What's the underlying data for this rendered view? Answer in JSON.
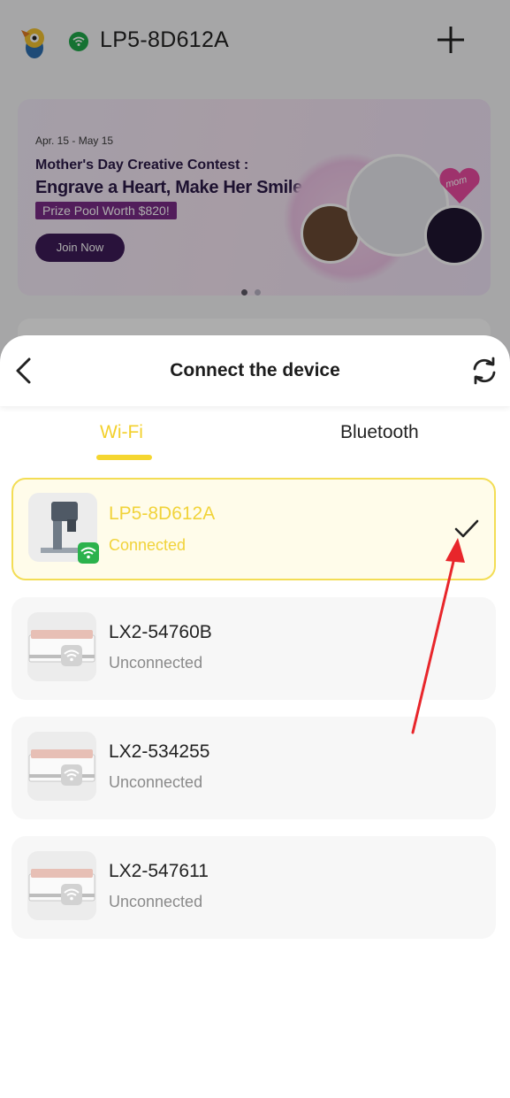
{
  "background": {
    "device_name": "LP5-8D612A",
    "banner": {
      "date": "Apr. 15 - May 15",
      "title_line1": "Mother's Day Creative Contest :",
      "title_line2": "Engrave a Heart, Make Her Smile",
      "prize": "Prize Pool Worth $820!",
      "join_label": "Join Now",
      "mom_tag": "mom"
    }
  },
  "sheet": {
    "title": "Connect the device",
    "tabs": [
      {
        "label": "Wi-Fi",
        "active": true
      },
      {
        "label": "Bluetooth",
        "active": false
      }
    ],
    "devices": [
      {
        "name": "LP5-8D612A",
        "status": "Connected",
        "selected": true,
        "icon": "laser-engraver-icon"
      },
      {
        "name": "LX2-54760B",
        "status": "Unconnected",
        "selected": false,
        "icon": "printer-box-icon"
      },
      {
        "name": "LX2-534255",
        "status": "Unconnected",
        "selected": false,
        "icon": "printer-box-icon"
      },
      {
        "name": "LX2-547611",
        "status": "Unconnected",
        "selected": false,
        "icon": "printer-box-icon"
      }
    ]
  },
  "colors": {
    "accent": "#f5d630",
    "connected_badge": "#2bb24c",
    "annotation_arrow": "#e8262b"
  }
}
